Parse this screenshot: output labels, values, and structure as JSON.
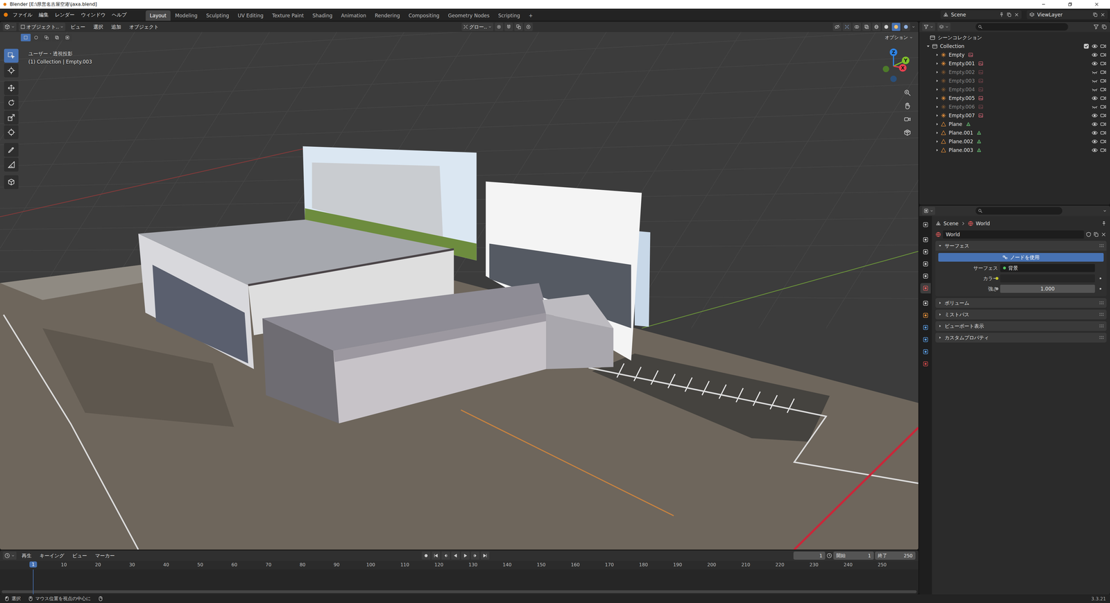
{
  "window": {
    "title": "Blender [E:\\県営名古屋空港\\jaxa.blend]"
  },
  "topbar": {
    "menus": [
      "ファイル",
      "編集",
      "レンダー",
      "ウィンドウ",
      "ヘルプ"
    ],
    "workspaces": [
      {
        "label": "Layout",
        "selected": true
      },
      {
        "label": "Modeling",
        "selected": false
      },
      {
        "label": "Sculpting",
        "selected": false
      },
      {
        "label": "UV Editing",
        "selected": false
      },
      {
        "label": "Texture Paint",
        "selected": false
      },
      {
        "label": "Shading",
        "selected": false
      },
      {
        "label": "Animation",
        "selected": false
      },
      {
        "label": "Rendering",
        "selected": false
      },
      {
        "label": "Compositing",
        "selected": false
      },
      {
        "label": "Geometry Nodes",
        "selected": false
      },
      {
        "label": "Scripting",
        "selected": false
      }
    ],
    "add_workspace": "+",
    "scene": "Scene",
    "view_layer": "ViewLayer"
  },
  "viewport": {
    "mode": "オブジェクト..",
    "menus": [
      "ビュー",
      "選択",
      "追加",
      "オブジェクト"
    ],
    "transform_orientation": "グロー..",
    "options": "オプション",
    "overlay_lines": [
      "ユーザー・透視投影",
      "(1) Collection | Empty.003"
    ],
    "tools": [
      {
        "selected": true
      },
      {
        "selected": false
      },
      {
        "selected": false
      },
      {
        "selected": false
      },
      {
        "selected": false
      },
      {
        "selected": false
      },
      {
        "selected": false
      },
      {
        "selected": false
      },
      {
        "selected": false
      }
    ],
    "select_modes": [
      {
        "selected": true
      },
      {
        "selected": false
      },
      {
        "selected": false
      },
      {
        "selected": false
      },
      {
        "selected": false
      }
    ],
    "shading_modes": [
      {
        "selected": false
      },
      {
        "selected": false
      },
      {
        "selected": true
      },
      {
        "selected": false
      }
    ],
    "gizmo_axes": [
      {
        "label": "Z",
        "color": "#2f83e3"
      },
      {
        "label": "Y",
        "color": "#7fbf2a"
      },
      {
        "label": "X",
        "color": "#e8404f"
      }
    ]
  },
  "outliner": {
    "root": "シーンコレクション",
    "collection": {
      "name": "Collection",
      "checked": true,
      "expanded": true
    },
    "items": [
      {
        "name": "Empty",
        "kind": "empty",
        "visible": true
      },
      {
        "name": "Empty.001",
        "kind": "empty",
        "visible": true
      },
      {
        "name": "Empty.002",
        "kind": "empty",
        "visible": false
      },
      {
        "name": "Empty.003",
        "kind": "empty",
        "visible": false
      },
      {
        "name": "Empty.004",
        "kind": "empty",
        "visible": false
      },
      {
        "name": "Empty.005",
        "kind": "empty",
        "visible": true
      },
      {
        "name": "Empty.006",
        "kind": "empty",
        "visible": false
      },
      {
        "name": "Empty.007",
        "kind": "empty",
        "visible": true
      },
      {
        "name": "Plane",
        "kind": "mesh",
        "visible": true
      },
      {
        "name": "Plane.001",
        "kind": "mesh",
        "visible": true
      },
      {
        "name": "Plane.002",
        "kind": "mesh",
        "visible": true
      },
      {
        "name": "Plane.003",
        "kind": "mesh",
        "visible": true
      }
    ]
  },
  "properties": {
    "tabs": [
      {
        "color": "#b8b8b8",
        "selected": false
      },
      {
        "color": "#d0d0d0",
        "selected": false
      },
      {
        "color": "#d0d0d0",
        "selected": false
      },
      {
        "color": "#d0d0d0",
        "selected": false
      },
      {
        "color": "#d0d0d0",
        "selected": false
      },
      {
        "color": "#e05a5a",
        "selected": true
      },
      {
        "color": "#d0d0d0",
        "selected": false
      },
      {
        "color": "#e8913a",
        "selected": false
      },
      {
        "color": "#5b9fe8",
        "selected": false
      },
      {
        "color": "#5b9fe8",
        "selected": false
      },
      {
        "color": "#5b9fe8",
        "selected": false
      },
      {
        "color": "#d04a4a",
        "selected": false
      }
    ],
    "breadcrumb": [
      "Scene",
      "World"
    ],
    "datablock": "World",
    "surface_panel": {
      "title": "サーフェス",
      "expanded": true,
      "button": "ノードを使用",
      "fields": [
        {
          "label": "サーフェス",
          "kind": "link",
          "value": "背景"
        },
        {
          "label": "カラー",
          "kind": "color",
          "value": ""
        },
        {
          "label": "強さ",
          "kind": "slider",
          "value": "1.000"
        }
      ]
    },
    "collapsed_panels": [
      {
        "title": "ボリューム",
        "expanded": false
      },
      {
        "title": "ミストパス",
        "expanded": false
      },
      {
        "title": "ビューポート表示",
        "expanded": false
      },
      {
        "title": "カスタムプロパティ",
        "expanded": false
      }
    ]
  },
  "timeline": {
    "menus": [
      "再生",
      "キーイング",
      "ビュー",
      "マーカー"
    ],
    "current_frame": "1",
    "frame_field": "1",
    "start_label": "開始",
    "start": "1",
    "end_label": "終了",
    "end": "250",
    "ruler": [
      "10",
      "20",
      "30",
      "40",
      "50",
      "60",
      "70",
      "80",
      "90",
      "100",
      "110",
      "120",
      "130",
      "140",
      "150",
      "160",
      "170",
      "180",
      "190",
      "200",
      "210",
      "220",
      "230",
      "240",
      "250"
    ]
  },
  "status_bar": {
    "items": [
      "選択",
      "マウス位置を視点の中心に"
    ],
    "version": "3.3.21"
  }
}
